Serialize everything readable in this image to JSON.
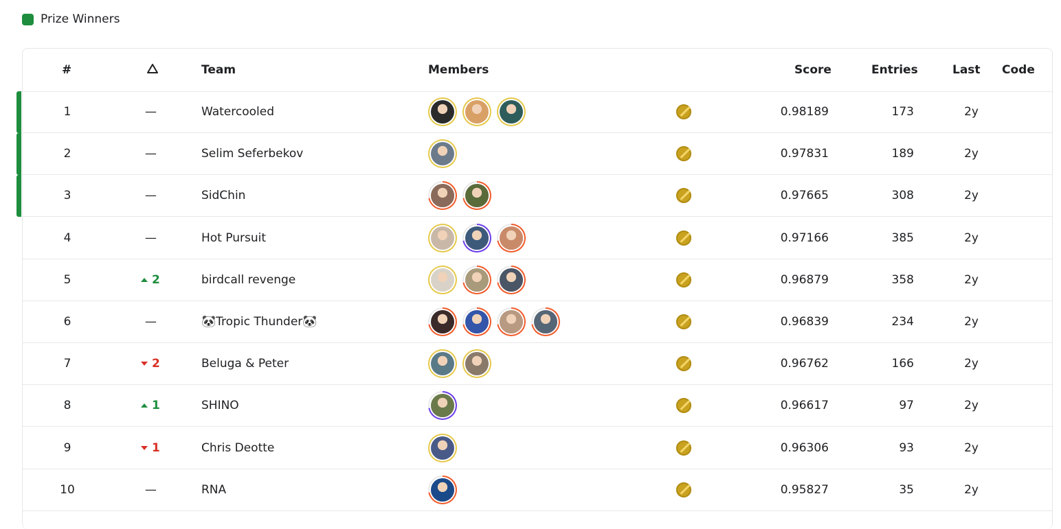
{
  "legend": {
    "label": "Prize Winners",
    "color": "#1e8e3e"
  },
  "columns": {
    "rank": "#",
    "change_icon": "triangle-delta-icon",
    "team": "Team",
    "members": "Members",
    "score": "Score",
    "entries": "Entries",
    "last": "Last",
    "code": "Code"
  },
  "rows": [
    {
      "rank": "1",
      "change": "—",
      "dir": "none",
      "team": "Watercooled",
      "prize": true,
      "members": [
        {
          "ring": "gold",
          "face": "#2b2b2b"
        },
        {
          "ring": "gold",
          "face": "#d9a066"
        },
        {
          "ring": "gold",
          "face": "#2f5d5b"
        }
      ],
      "medal": "gold",
      "score": "0.98189",
      "entries": "173",
      "last": "2y"
    },
    {
      "rank": "2",
      "change": "—",
      "dir": "none",
      "team": "Selim Seferbekov",
      "prize": true,
      "members": [
        {
          "ring": "gold",
          "face": "#6b7b8c"
        }
      ],
      "medal": "gold",
      "score": "0.97831",
      "entries": "189",
      "last": "2y"
    },
    {
      "rank": "3",
      "change": "—",
      "dir": "none",
      "team": "SidChin",
      "prize": true,
      "members": [
        {
          "ring": "orange",
          "face": "#8a6a5a"
        },
        {
          "ring": "orange",
          "face": "#5a6b3a"
        }
      ],
      "medal": "gold",
      "score": "0.97665",
      "entries": "308",
      "last": "2y"
    },
    {
      "rank": "4",
      "change": "—",
      "dir": "none",
      "team": "Hot Pursuit",
      "prize": false,
      "members": [
        {
          "ring": "gold",
          "face": "#c9b8a8"
        },
        {
          "ring": "purple",
          "face": "#3d5a7a"
        },
        {
          "ring": "orange",
          "face": "#c98a6a"
        }
      ],
      "medal": "gold",
      "score": "0.97166",
      "entries": "385",
      "last": "2y"
    },
    {
      "rank": "5",
      "change": "2",
      "dir": "up",
      "team": "birdcall revenge",
      "prize": false,
      "members": [
        {
          "ring": "gold",
          "face": "#d8d2c8"
        },
        {
          "ring": "orange",
          "face": "#a89a7a"
        },
        {
          "ring": "orange",
          "face": "#4a5566"
        }
      ],
      "medal": "gold",
      "score": "0.96879",
      "entries": "358",
      "last": "2y"
    },
    {
      "rank": "6",
      "change": "—",
      "dir": "none",
      "team": "🐼Tropic Thunder🐼",
      "prize": false,
      "members": [
        {
          "ring": "orange",
          "face": "#3a2a2a"
        },
        {
          "ring": "orange",
          "face": "#3355aa"
        },
        {
          "ring": "orange",
          "face": "#b89a82"
        },
        {
          "ring": "orange",
          "face": "#556677"
        }
      ],
      "medal": "gold",
      "score": "0.96839",
      "entries": "234",
      "last": "2y"
    },
    {
      "rank": "7",
      "change": "2",
      "dir": "down",
      "team": "Beluga & Peter",
      "prize": false,
      "members": [
        {
          "ring": "gold",
          "face": "#5a7a88"
        },
        {
          "ring": "gold",
          "face": "#8a7a6a"
        }
      ],
      "medal": "gold",
      "score": "0.96762",
      "entries": "166",
      "last": "2y"
    },
    {
      "rank": "8",
      "change": "1",
      "dir": "up",
      "team": "SHINO",
      "prize": false,
      "members": [
        {
          "ring": "purple",
          "face": "#6a7a4a"
        }
      ],
      "medal": "gold",
      "score": "0.96617",
      "entries": "97",
      "last": "2y"
    },
    {
      "rank": "9",
      "change": "1",
      "dir": "down",
      "team": "Chris Deotte",
      "prize": false,
      "members": [
        {
          "ring": "gold",
          "face": "#4a5a88"
        }
      ],
      "medal": "gold",
      "score": "0.96306",
      "entries": "93",
      "last": "2y"
    },
    {
      "rank": "10",
      "change": "—",
      "dir": "none",
      "team": "RNA",
      "prize": false,
      "members": [
        {
          "ring": "orange",
          "face": "#1a4a8a"
        }
      ],
      "medal": "gold",
      "score": "0.95827",
      "entries": "35",
      "last": "2y"
    }
  ],
  "colors": {
    "gold_ring": "#e6c84a",
    "orange_ring": "#f05a28",
    "purple_ring": "#6a3de8",
    "up": "#1e8e3e",
    "down": "#d93025"
  }
}
